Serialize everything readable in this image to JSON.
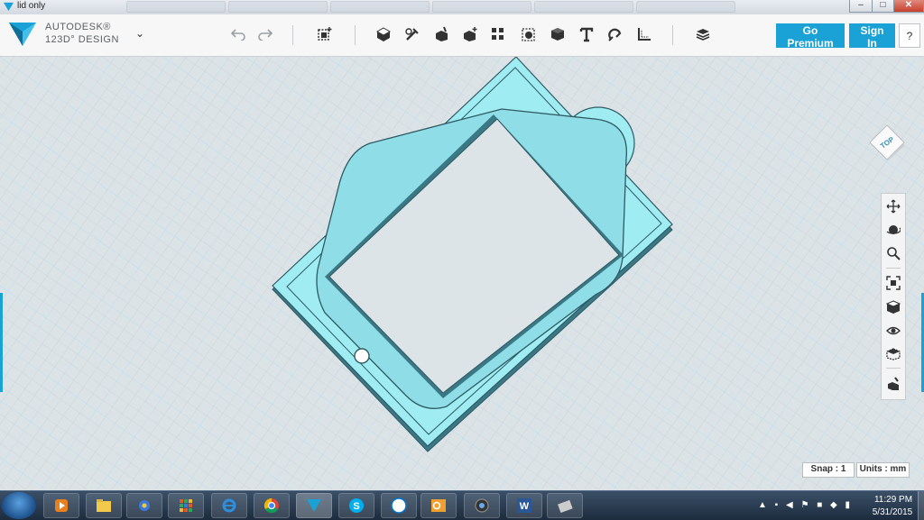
{
  "window": {
    "title": "lid only",
    "ghost_tabs": [
      "",
      "",
      "",
      "",
      "",
      "",
      "",
      ""
    ],
    "minimize": "–",
    "maximize": "□",
    "close": "✕"
  },
  "app": {
    "brand_line1": "AUTODESK®",
    "brand_line2": "123D° DESIGN",
    "menu_chevron": "⌄"
  },
  "toolbar": {
    "tools": [
      "undo-icon",
      "redo-icon",
      "primitives-icon",
      "sketch-icon",
      "construct-icon",
      "modify-icon",
      "pattern-icon",
      "grouping-icon",
      "combine-icon",
      "text-icon",
      "snap-icon",
      "measure-icon",
      "material-icon"
    ],
    "premium_label": "Go Premium",
    "signin_label": "Sign In",
    "help_label": "?",
    "accent": "#1aa2d6"
  },
  "viewcube": {
    "label": "TOP"
  },
  "navbar": {
    "tools": [
      "pan-icon",
      "orbit-icon",
      "zoom-icon",
      "fit-icon",
      "views-icon",
      "visibility-icon",
      "material-display-icon",
      "settings-icon"
    ]
  },
  "status": {
    "snap": "Snap : 1",
    "units": "Units : mm"
  },
  "model": {
    "color": "#9fecf2",
    "edge": "#2e5a64"
  },
  "taskbar": {
    "apps": [
      "media-player-icon",
      "file-explorer-icon",
      "game-icon",
      "app-grid-icon",
      "internet-explorer-icon",
      "chrome-icon",
      "autodesk-123d-icon",
      "skype-icon",
      "dell-icon",
      "outlook-icon",
      "camera-icon",
      "word-icon",
      "misc-app-icon"
    ],
    "time": "11:29 PM",
    "date": "5/31/2015"
  }
}
